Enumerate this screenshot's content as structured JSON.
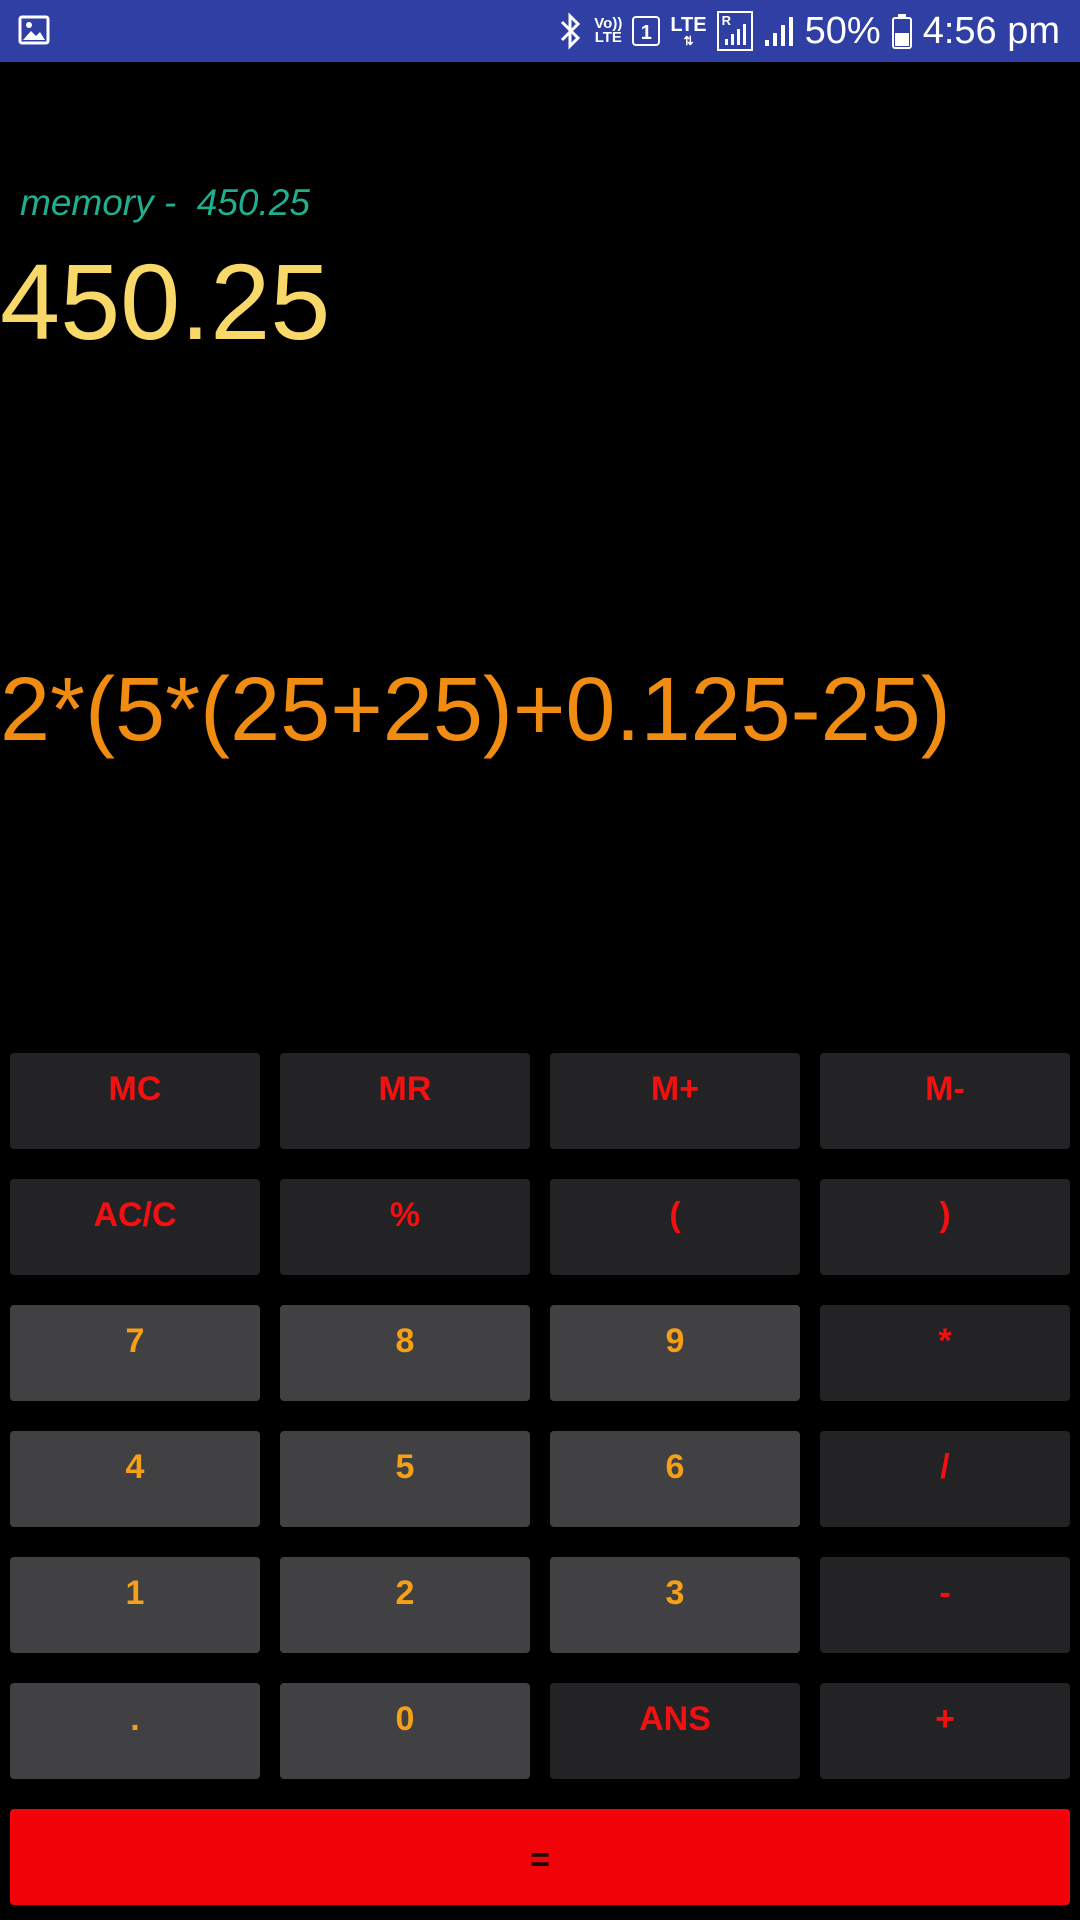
{
  "status_bar": {
    "vo_lte_top": "Vo))",
    "vo_lte_bottom": "LTE",
    "sim_slot": "1",
    "lte_label": "LTE",
    "roaming": "R",
    "battery_percent": "50%",
    "time": "4:56 pm",
    "background": "#2f3fa4"
  },
  "display": {
    "memory_label": "memory -  450.25",
    "result": "450.25",
    "expression": "2*(5*(25+25)+0.125-25)"
  },
  "keys": {
    "mc": "MC",
    "mr": "MR",
    "m_plus": "M+",
    "m_minus": "M-",
    "ac_c": "AC/C",
    "percent": "%",
    "open_paren": "(",
    "close_paren": ")",
    "seven": "7",
    "eight": "8",
    "nine": "9",
    "multiply": "*",
    "four": "4",
    "five": "5",
    "six": "6",
    "divide": "/",
    "one": "1",
    "two": "2",
    "three": "3",
    "minus": "-",
    "decimal": ".",
    "zero": "0",
    "ans": "ANS",
    "plus": "+",
    "equals": "="
  },
  "colors": {
    "memory_text": "#1fae8e",
    "result_text": "#f9d86a",
    "expression_text": "#f08c12",
    "function_key_text": "#f41010",
    "digit_key_text": "#f5a017",
    "dark_key_bg": "#232325",
    "light_key_bg": "#414143",
    "equals_bg": "#f20308"
  }
}
